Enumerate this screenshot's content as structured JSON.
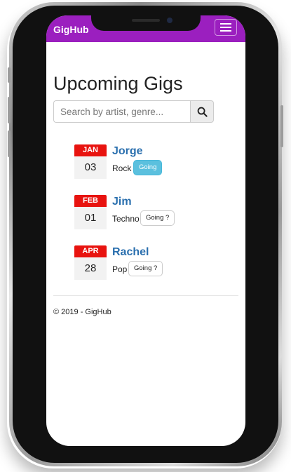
{
  "app": {
    "brand": "GigHub",
    "menu_icon": "hamburger-menu-icon",
    "accent_color": "#9b1fbf"
  },
  "main": {
    "title": "Upcoming Gigs",
    "search": {
      "placeholder": "Search by artist, genre...",
      "value": "",
      "button_icon": "search-icon"
    },
    "gigs": [
      {
        "month": "JAN",
        "day": "03",
        "artist": "Jorge",
        "genre": "Rock",
        "going_label": "Going",
        "going": true
      },
      {
        "month": "FEB",
        "day": "01",
        "artist": "Jim",
        "genre": "Techno",
        "going_label": "Going ?",
        "going": false
      },
      {
        "month": "APR",
        "day": "28",
        "artist": "Rachel",
        "genre": "Pop",
        "going_label": "Going ?",
        "going": false
      }
    ]
  },
  "footer": {
    "text": "© 2019 - GigHub"
  },
  "colors": {
    "calendar_month": "#e8130f",
    "artist_link": "#2a6fae",
    "going_active": "#5bc0de"
  }
}
